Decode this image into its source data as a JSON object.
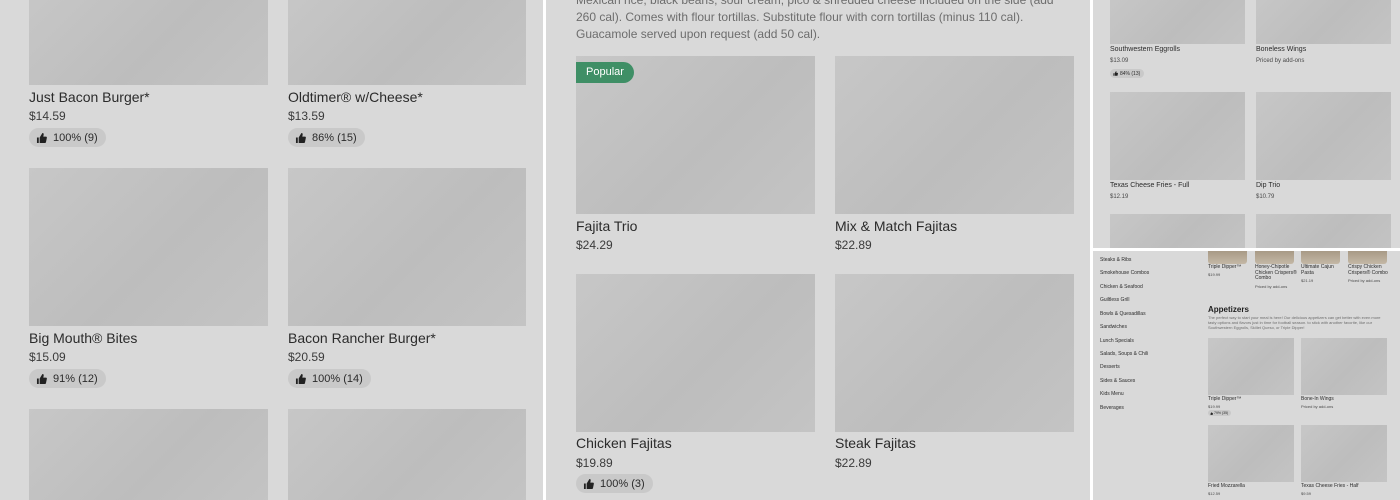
{
  "panel_a": {
    "items": [
      {
        "name": "Just Bacon Burger*",
        "price": "$14.59",
        "rating": "100% (9)"
      },
      {
        "name": "Oldtimer® w/Cheese*",
        "price": "$13.59",
        "rating": "86% (15)"
      },
      {
        "name": "Big Mouth® Bites",
        "price": "$15.09",
        "rating": "91% (12)"
      },
      {
        "name": "Bacon Rancher Burger*",
        "price": "$20.59",
        "rating": "100% (14)"
      }
    ]
  },
  "panel_b": {
    "description": "Mexican rice, black beans, sour cream, pico & shredded cheese included on the side (add 260 cal). Comes with flour tortillas. Substitute flour with corn tortillas (minus 110 cal). Guacamole served upon request (add 50 cal).",
    "badge": "Popular",
    "items": [
      {
        "name": "Fajita Trio",
        "price": "$24.29"
      },
      {
        "name": "Mix & Match Fajitas",
        "price": "$22.89"
      },
      {
        "name": "Chicken Fajitas",
        "price": "$19.89",
        "rating": "100% (3)"
      },
      {
        "name": "Steak Fajitas",
        "price": "$22.89"
      }
    ]
  },
  "panel_c": {
    "items": [
      {
        "name": "Southwestern Eggrolls",
        "price": "$13.09",
        "rating": "84% (13)"
      },
      {
        "name": "Boneless Wings",
        "price": "Priced by add-ons"
      },
      {
        "name": "Texas Cheese Fries - Full",
        "price": "$12.19"
      },
      {
        "name": "Dip Trio",
        "price": "$10.79"
      }
    ]
  },
  "panel_d": {
    "categories": [
      "Steaks & Ribs",
      "Smokehouse Combos",
      "Chicken & Seafood",
      "Guiltless Grill",
      "Bowls & Quesadillas",
      "Sandwiches",
      "Lunch Specials",
      "Salads, Soups & Chili",
      "Desserts",
      "Sides & Sauces",
      "Kids Menu",
      "Beverages"
    ],
    "featured": [
      {
        "name": "Triple Dipper™",
        "price": "$19.99"
      },
      {
        "name": "Honey-Chipotle Chicken Crispers® Combo",
        "price": "Priced by add-ons"
      },
      {
        "name": "Ultimate Cajun Pasta",
        "price": "$21.19"
      },
      {
        "name": "Crispy Chicken Crispers® Combo",
        "price": "Priced by add-ons"
      }
    ],
    "section_title": "Appetizers",
    "section_desc": "The perfect way to start your meal is here! Our delicious appetizers can get better with even more tasty options and flavors just in time for football season. to stick with another favorite, like our Southwestern Eggrolls, Skillet Queso, or Triple Dipper!",
    "items": [
      {
        "name": "Triple Dipper™",
        "price": "$19.99",
        "rating": "79% (35)"
      },
      {
        "name": "Bone-In Wings",
        "price": "Priced by add-ons"
      },
      {
        "name": "Fried Mozzarella",
        "price": "$12.59"
      },
      {
        "name": "Texas Cheese Fries - Half",
        "price": "$9.59"
      }
    ]
  }
}
